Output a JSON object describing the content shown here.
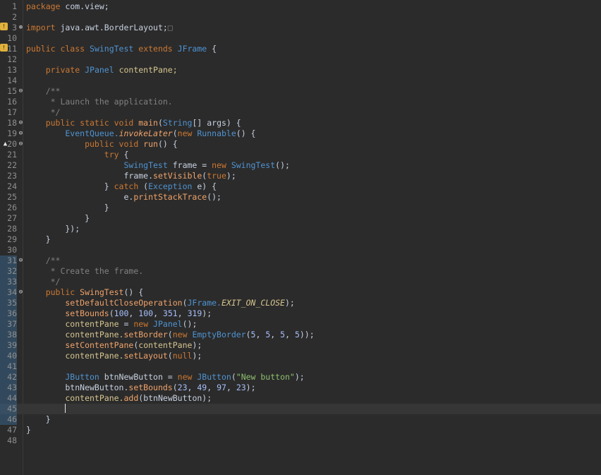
{
  "editor": {
    "language": "Java",
    "current_line": 45,
    "lines": [
      {
        "num": "1",
        "segments": [
          {
            "t": "package ",
            "c": "kw"
          },
          {
            "t": "com.view;",
            "c": "var"
          }
        ]
      },
      {
        "num": "2",
        "segments": []
      },
      {
        "num": "3",
        "segments": [
          {
            "t": "import ",
            "c": "kw"
          },
          {
            "t": "java.awt.BorderLayout;",
            "c": "var"
          },
          {
            "t": "□",
            "c": "com"
          }
        ]
      },
      {
        "num": "10",
        "segments": []
      },
      {
        "num": "11",
        "segments": [
          {
            "t": "public class ",
            "c": "kw"
          },
          {
            "t": "SwingTest ",
            "c": "type"
          },
          {
            "t": "extends ",
            "c": "kw"
          },
          {
            "t": "JFrame ",
            "c": "type"
          },
          {
            "t": "{",
            "c": "var"
          }
        ]
      },
      {
        "num": "12",
        "segments": []
      },
      {
        "num": "13",
        "segments": [
          {
            "t": "    private ",
            "c": "kw"
          },
          {
            "t": "JPanel ",
            "c": "type"
          },
          {
            "t": "contentPane;",
            "c": "field"
          }
        ]
      },
      {
        "num": "14",
        "segments": []
      },
      {
        "num": "15",
        "segments": [
          {
            "t": "    /**",
            "c": "com"
          }
        ]
      },
      {
        "num": "16",
        "segments": [
          {
            "t": "     * Launch the application.",
            "c": "com"
          }
        ]
      },
      {
        "num": "17",
        "segments": [
          {
            "t": "     */",
            "c": "com"
          }
        ]
      },
      {
        "num": "18",
        "segments": [
          {
            "t": "    public static void ",
            "c": "kw"
          },
          {
            "t": "main",
            "c": "method"
          },
          {
            "t": "(",
            "c": "var"
          },
          {
            "t": "String",
            "c": "type"
          },
          {
            "t": "[] ",
            "c": "var"
          },
          {
            "t": "args",
            "c": "var"
          },
          {
            "t": ") {",
            "c": "var"
          }
        ]
      },
      {
        "num": "19",
        "segments": [
          {
            "t": "        EventQueue.",
            "c": "type"
          },
          {
            "t": "invokeLater",
            "c": "method italic"
          },
          {
            "t": "(",
            "c": "var"
          },
          {
            "t": "new ",
            "c": "kw"
          },
          {
            "t": "Runnable",
            "c": "type"
          },
          {
            "t": "() {",
            "c": "var"
          }
        ]
      },
      {
        "num": "20",
        "segments": [
          {
            "t": "            public void ",
            "c": "kw"
          },
          {
            "t": "run",
            "c": "method"
          },
          {
            "t": "() {",
            "c": "var"
          }
        ]
      },
      {
        "num": "21",
        "segments": [
          {
            "t": "                try ",
            "c": "kw"
          },
          {
            "t": "{",
            "c": "var"
          }
        ]
      },
      {
        "num": "22",
        "segments": [
          {
            "t": "                    SwingTest ",
            "c": "type"
          },
          {
            "t": "frame ",
            "c": "var"
          },
          {
            "t": "= ",
            "c": "var"
          },
          {
            "t": "new ",
            "c": "kw"
          },
          {
            "t": "SwingTest",
            "c": "type"
          },
          {
            "t": "();",
            "c": "var"
          }
        ]
      },
      {
        "num": "23",
        "segments": [
          {
            "t": "                    frame.",
            "c": "var"
          },
          {
            "t": "setVisible",
            "c": "method"
          },
          {
            "t": "(",
            "c": "var"
          },
          {
            "t": "true",
            "c": "kw"
          },
          {
            "t": ");",
            "c": "var"
          }
        ]
      },
      {
        "num": "24",
        "segments": [
          {
            "t": "                } ",
            "c": "var"
          },
          {
            "t": "catch ",
            "c": "kw"
          },
          {
            "t": "(",
            "c": "var"
          },
          {
            "t": "Exception ",
            "c": "type"
          },
          {
            "t": "e) {",
            "c": "var"
          }
        ]
      },
      {
        "num": "25",
        "segments": [
          {
            "t": "                    e.",
            "c": "var"
          },
          {
            "t": "printStackTrace",
            "c": "method"
          },
          {
            "t": "();",
            "c": "var"
          }
        ]
      },
      {
        "num": "26",
        "segments": [
          {
            "t": "                }",
            "c": "var"
          }
        ]
      },
      {
        "num": "27",
        "segments": [
          {
            "t": "            }",
            "c": "var"
          }
        ]
      },
      {
        "num": "28",
        "segments": [
          {
            "t": "        });",
            "c": "var"
          }
        ]
      },
      {
        "num": "29",
        "segments": [
          {
            "t": "    }",
            "c": "var"
          }
        ]
      },
      {
        "num": "30",
        "segments": []
      },
      {
        "num": "31",
        "segments": [
          {
            "t": "    /**",
            "c": "com"
          }
        ]
      },
      {
        "num": "32",
        "segments": [
          {
            "t": "     * Create the frame.",
            "c": "com"
          }
        ]
      },
      {
        "num": "33",
        "segments": [
          {
            "t": "     */",
            "c": "com"
          }
        ]
      },
      {
        "num": "34",
        "segments": [
          {
            "t": "    public ",
            "c": "kw"
          },
          {
            "t": "SwingTest",
            "c": "method"
          },
          {
            "t": "() {",
            "c": "var"
          }
        ]
      },
      {
        "num": "35",
        "segments": [
          {
            "t": "        setDefaultCloseOperation",
            "c": "method"
          },
          {
            "t": "(",
            "c": "var"
          },
          {
            "t": "JFrame.",
            "c": "type"
          },
          {
            "t": "EXIT_ON_CLOSE",
            "c": "field italic"
          },
          {
            "t": ");",
            "c": "var"
          }
        ]
      },
      {
        "num": "36",
        "segments": [
          {
            "t": "        setBounds",
            "c": "method"
          },
          {
            "t": "(",
            "c": "var"
          },
          {
            "t": "100",
            "c": "num"
          },
          {
            "t": ", ",
            "c": "var"
          },
          {
            "t": "100",
            "c": "num"
          },
          {
            "t": ", ",
            "c": "var"
          },
          {
            "t": "351",
            "c": "num"
          },
          {
            "t": ", ",
            "c": "var"
          },
          {
            "t": "319",
            "c": "num"
          },
          {
            "t": ");",
            "c": "var"
          }
        ]
      },
      {
        "num": "37",
        "segments": [
          {
            "t": "        contentPane ",
            "c": "field"
          },
          {
            "t": "= ",
            "c": "var"
          },
          {
            "t": "new ",
            "c": "kw"
          },
          {
            "t": "JPanel",
            "c": "type"
          },
          {
            "t": "();",
            "c": "var"
          }
        ]
      },
      {
        "num": "38",
        "segments": [
          {
            "t": "        contentPane.",
            "c": "field"
          },
          {
            "t": "setBorder",
            "c": "method"
          },
          {
            "t": "(",
            "c": "var"
          },
          {
            "t": "new ",
            "c": "kw"
          },
          {
            "t": "EmptyBorder",
            "c": "type"
          },
          {
            "t": "(",
            "c": "var"
          },
          {
            "t": "5",
            "c": "num"
          },
          {
            "t": ", ",
            "c": "var"
          },
          {
            "t": "5",
            "c": "num"
          },
          {
            "t": ", ",
            "c": "var"
          },
          {
            "t": "5",
            "c": "num"
          },
          {
            "t": ", ",
            "c": "var"
          },
          {
            "t": "5",
            "c": "num"
          },
          {
            "t": "));",
            "c": "var"
          }
        ]
      },
      {
        "num": "39",
        "segments": [
          {
            "t": "        setContentPane",
            "c": "method"
          },
          {
            "t": "(",
            "c": "var"
          },
          {
            "t": "contentPane",
            "c": "field"
          },
          {
            "t": ");",
            "c": "var"
          }
        ]
      },
      {
        "num": "40",
        "segments": [
          {
            "t": "        contentPane.",
            "c": "field"
          },
          {
            "t": "setLayout",
            "c": "method"
          },
          {
            "t": "(",
            "c": "var"
          },
          {
            "t": "null",
            "c": "kw"
          },
          {
            "t": ");",
            "c": "var"
          }
        ]
      },
      {
        "num": "41",
        "segments": []
      },
      {
        "num": "42",
        "segments": [
          {
            "t": "        JButton ",
            "c": "type"
          },
          {
            "t": "btnNewButton ",
            "c": "var"
          },
          {
            "t": "= ",
            "c": "var"
          },
          {
            "t": "new ",
            "c": "kw"
          },
          {
            "t": "JButton",
            "c": "type"
          },
          {
            "t": "(",
            "c": "var"
          },
          {
            "t": "\"New button\"",
            "c": "str"
          },
          {
            "t": ");",
            "c": "var"
          }
        ]
      },
      {
        "num": "43",
        "segments": [
          {
            "t": "        btnNewButton.",
            "c": "var"
          },
          {
            "t": "setBounds",
            "c": "method"
          },
          {
            "t": "(",
            "c": "var"
          },
          {
            "t": "23",
            "c": "num"
          },
          {
            "t": ", ",
            "c": "var"
          },
          {
            "t": "49",
            "c": "num"
          },
          {
            "t": ", ",
            "c": "var"
          },
          {
            "t": "97",
            "c": "num"
          },
          {
            "t": ", ",
            "c": "var"
          },
          {
            "t": "23",
            "c": "num"
          },
          {
            "t": ");",
            "c": "var"
          }
        ]
      },
      {
        "num": "44",
        "segments": [
          {
            "t": "        contentPane.",
            "c": "field"
          },
          {
            "t": "add",
            "c": "method"
          },
          {
            "t": "(",
            "c": "var"
          },
          {
            "t": "btnNewButton",
            "c": "var"
          },
          {
            "t": ");",
            "c": "var"
          }
        ]
      },
      {
        "num": "45",
        "segments": [
          {
            "t": "        ",
            "c": "var"
          },
          {
            "t": "",
            "c": "cursor"
          }
        ]
      },
      {
        "num": "46",
        "segments": [
          {
            "t": "    }",
            "c": "var"
          }
        ]
      },
      {
        "num": "47",
        "segments": [
          {
            "t": "}",
            "c": "var"
          }
        ]
      },
      {
        "num": "48",
        "segments": []
      }
    ],
    "fold_markers": [
      "3",
      "15",
      "18",
      "19",
      "20",
      "31",
      "34"
    ],
    "warning_lines": [
      "3",
      "11"
    ],
    "override_marker_line": "20",
    "changed_lines": [
      "31",
      "32",
      "33",
      "34",
      "35",
      "36",
      "37",
      "38",
      "39",
      "40",
      "41",
      "42",
      "43",
      "44",
      "45",
      "46"
    ]
  }
}
